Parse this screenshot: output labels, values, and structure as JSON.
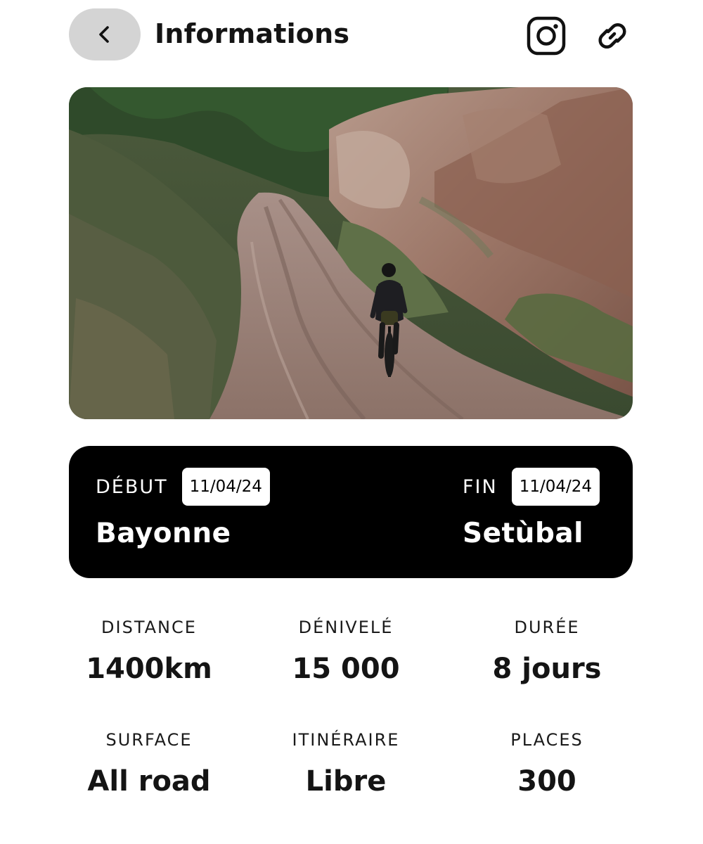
{
  "header": {
    "title": "Informations",
    "back_icon": "chevron-left-icon",
    "actions": [
      {
        "icon": "instagram-icon"
      },
      {
        "icon": "link-icon"
      }
    ]
  },
  "hero": {
    "subject": "cyclist on dirt gravel road through rocky hills"
  },
  "route": {
    "start_label": "DÉBUT",
    "start_date": "11/04/24",
    "start_city": "Bayonne",
    "end_label": "FIN",
    "end_date": "11/04/24",
    "end_city": "Setùbal"
  },
  "stats": [
    {
      "label": "DISTANCE",
      "value": "1400km"
    },
    {
      "label": "DÉNIVELÉ",
      "value": "15 000"
    },
    {
      "label": "DURÉE",
      "value": "8 jours"
    },
    {
      "label": "SURFACE",
      "value": "All road"
    },
    {
      "label": "ITINÉRAIRE",
      "value": "Libre"
    },
    {
      "label": "PLACES",
      "value": "300"
    }
  ],
  "colors": {
    "back_button_bg": "#d4d4d4",
    "card_bg": "#000000",
    "text": "#141414"
  }
}
